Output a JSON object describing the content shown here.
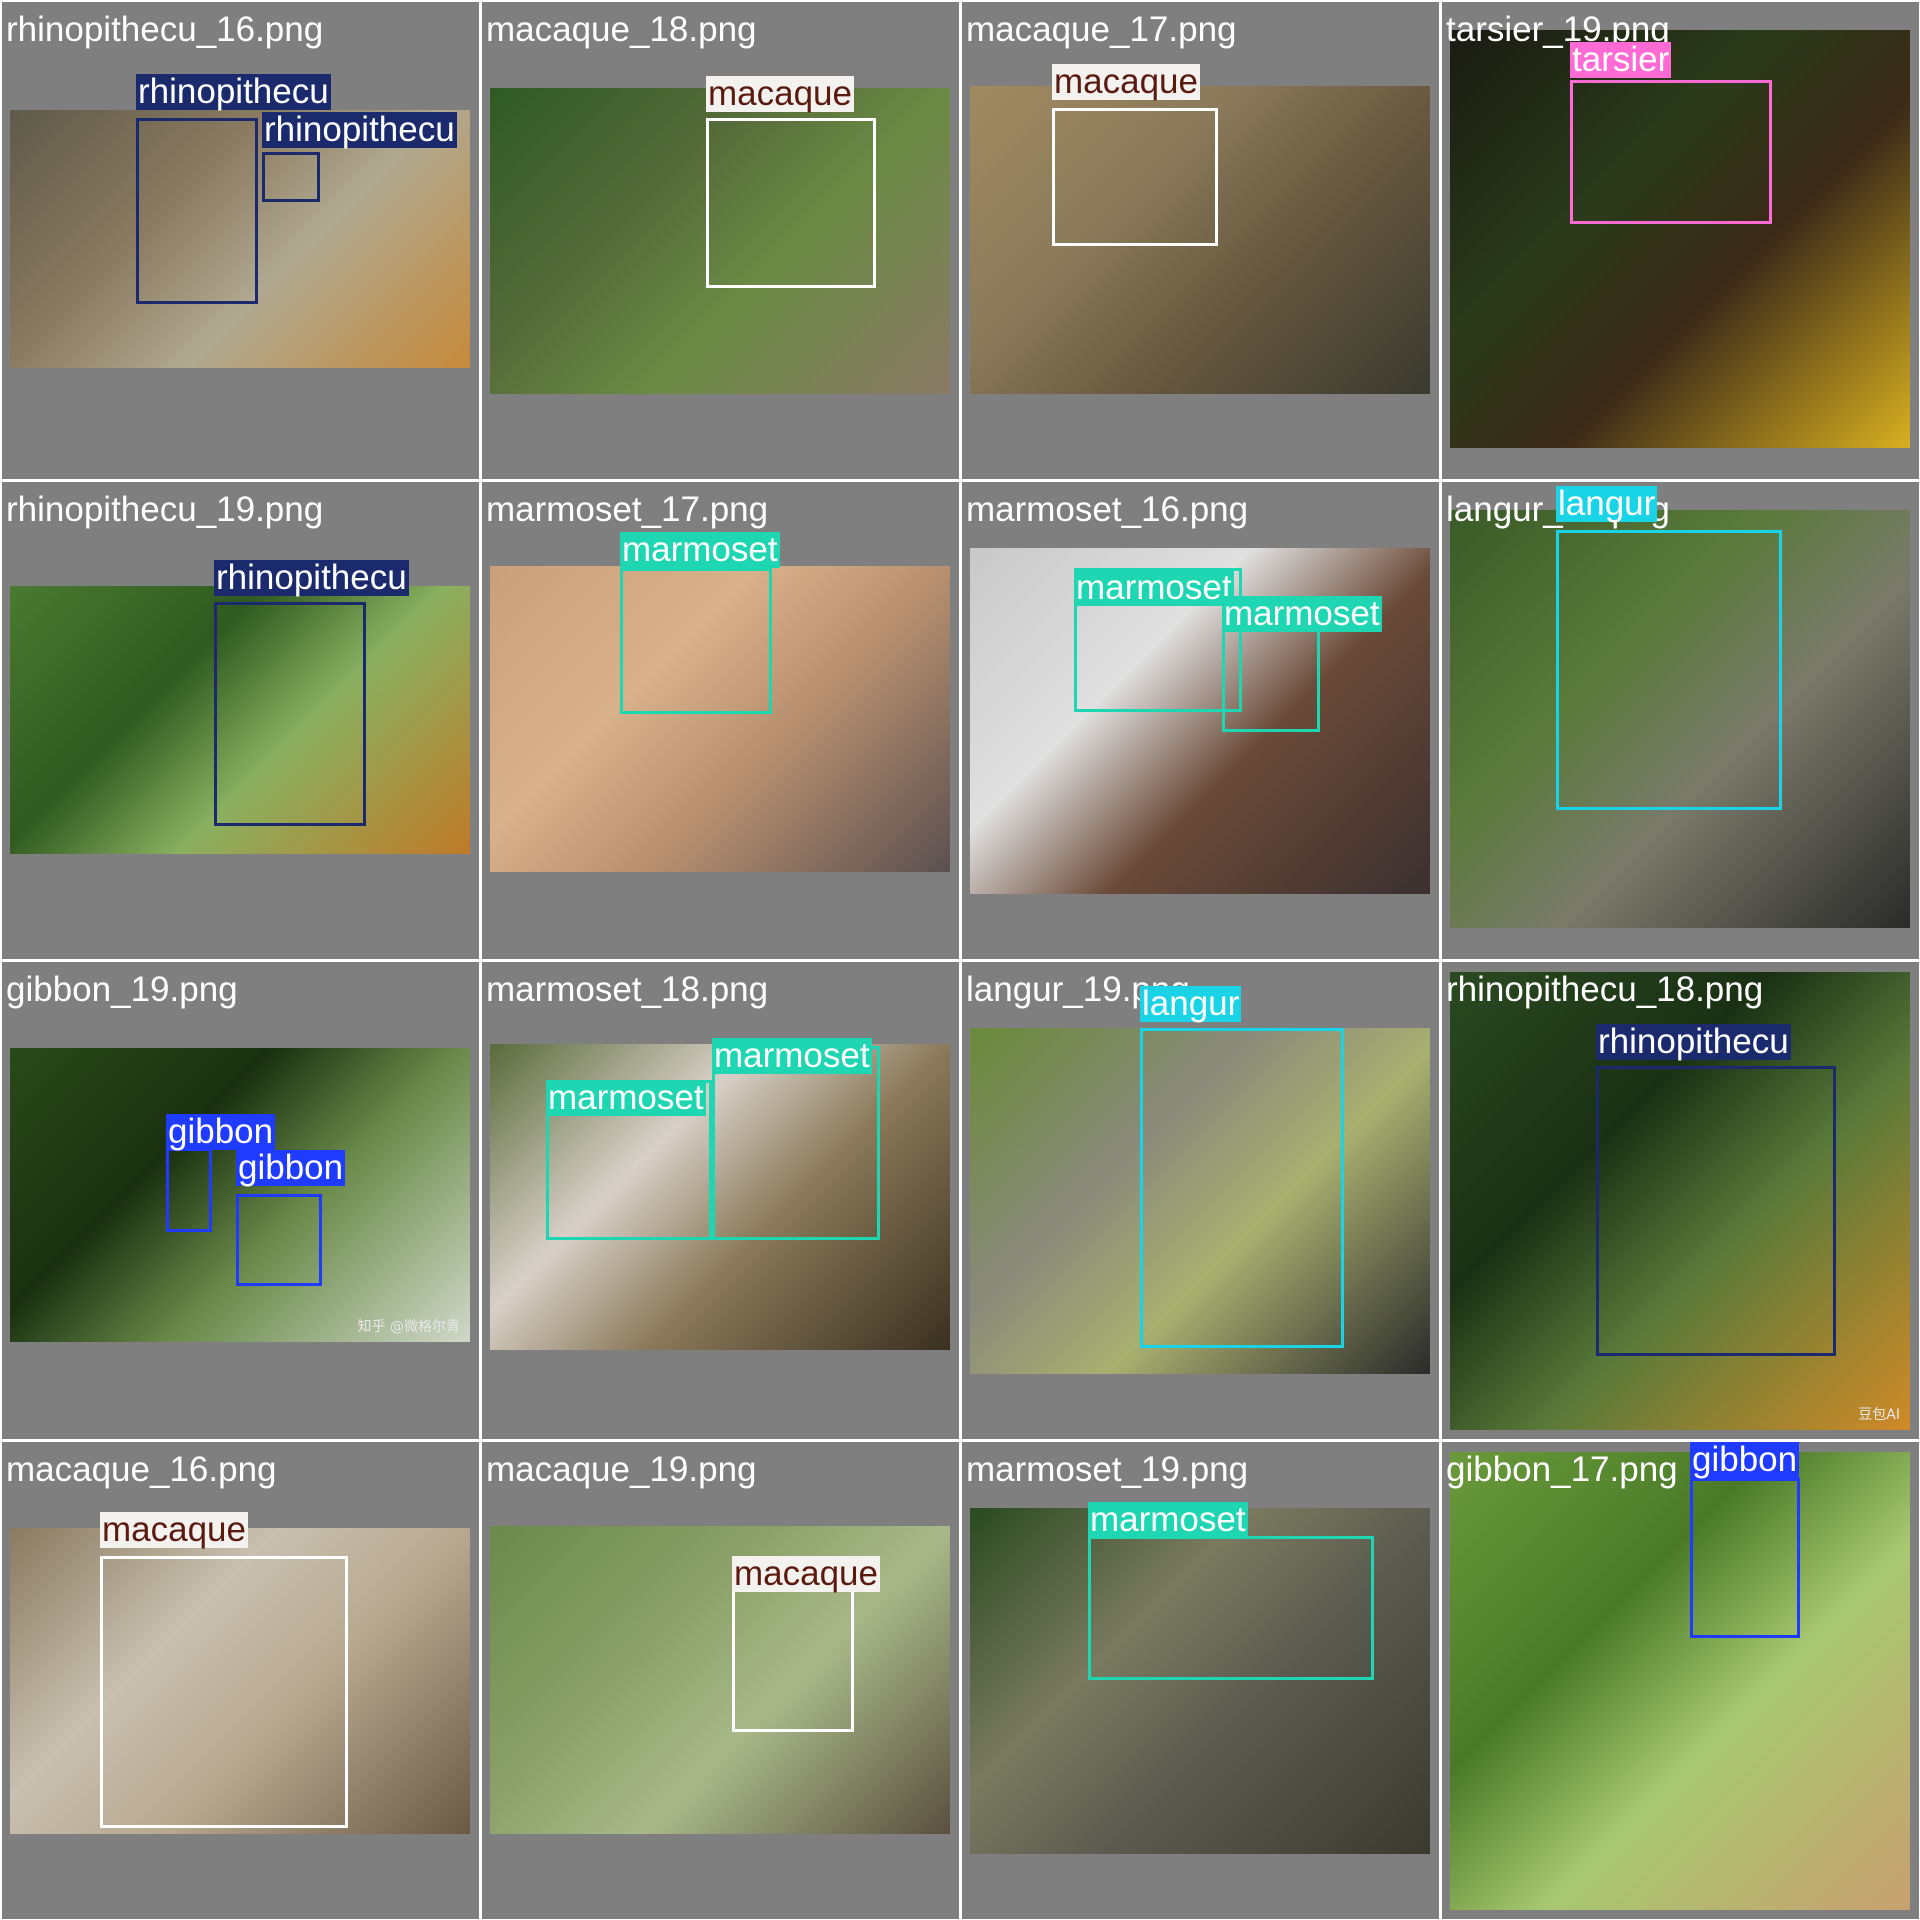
{
  "colors": {
    "background": "#7f7f7f",
    "macaque": "#ffffff",
    "rhinopithecu": "#1a2a6c",
    "tarsier": "#ff6ad5",
    "marmoset": "#1fd6b2",
    "langur": "#19d3e6",
    "gibbon": "#1f3bff"
  },
  "cells": [
    {
      "filename": "rhinopithecu_16.png",
      "photo_desc": "golden snub-nosed monkeys on rocks",
      "photo_colors": [
        "#5f5a4a",
        "#b0a890",
        "#c68a3a",
        "#8a7a60"
      ],
      "detections": [
        {
          "label": "rhinopithecu"
        },
        {
          "label": "rhinopithecu"
        }
      ]
    },
    {
      "filename": "macaque_18.png",
      "photo_desc": "macaque sitting on stone wall in greenery",
      "photo_colors": [
        "#2f5a24",
        "#6a8a44",
        "#8a7a66",
        "#556b3a"
      ],
      "detections": [
        {
          "label": "macaque"
        }
      ]
    },
    {
      "filename": "macaque_17.png",
      "photo_desc": "macaque walking near tree trunk",
      "photo_colors": [
        "#a08a60",
        "#6a5a40",
        "#3a3a30",
        "#8a7a5a"
      ],
      "detections": [
        {
          "label": "macaque"
        }
      ]
    },
    {
      "filename": "tarsier_19.png",
      "photo_desc": "slow loris on branch with yellow flowers",
      "photo_colors": [
        "#1a1a12",
        "#3a2a18",
        "#d8b020",
        "#2a3a1a"
      ],
      "detections": [
        {
          "label": "tarsier"
        }
      ]
    },
    {
      "filename": "rhinopithecu_19.png",
      "photo_desc": "golden snub-nosed monkey among leaves",
      "photo_colors": [
        "#4a7a30",
        "#8ab060",
        "#c07a28",
        "#2f5a20"
      ],
      "detections": [
        {
          "label": "rhinopithecu"
        }
      ]
    },
    {
      "filename": "marmoset_17.png",
      "photo_desc": "marmoset clinging to finger",
      "photo_colors": [
        "#c9a07a",
        "#b89070",
        "#5a5050",
        "#d8b08a"
      ],
      "detections": [
        {
          "label": "marmoset"
        }
      ]
    },
    {
      "filename": "marmoset_16.png",
      "photo_desc": "two marmosets on a log",
      "photo_colors": [
        "#c8c8c8",
        "#6a4a38",
        "#3a3030",
        "#e0e0e0"
      ],
      "detections": [
        {
          "label": "marmoset"
        },
        {
          "label": "marmoset"
        }
      ]
    },
    {
      "filename": "langur_16.png",
      "photo_desc": "dusky langur on mossy branch",
      "photo_colors": [
        "#3a5a28",
        "#7a7a6a",
        "#2a2a2a",
        "#5a7a3a"
      ],
      "detections": [
        {
          "label": "langur"
        }
      ]
    },
    {
      "filename": "gibbon_19.png",
      "photo_desc": "two gibbons in dense canopy",
      "photo_colors": [
        "#2a4a1a",
        "#6a8a4a",
        "#d0d8c8",
        "#1a3010"
      ],
      "detections": [
        {
          "label": "gibbon"
        },
        {
          "label": "gibbon"
        }
      ],
      "watermark": "知乎 @微格尔青"
    },
    {
      "filename": "marmoset_18.png",
      "photo_desc": "two tufted marmosets on mossy branch",
      "photo_colors": [
        "#5a6a3a",
        "#8a7a5a",
        "#3a3020",
        "#d8d0c8"
      ],
      "detections": [
        {
          "label": "marmoset"
        },
        {
          "label": "marmoset"
        }
      ]
    },
    {
      "filename": "langur_19.png",
      "photo_desc": "dusky langur holding tree trunk",
      "photo_colors": [
        "#6a8a3a",
        "#a8b070",
        "#2a2a2a",
        "#8a8a7a"
      ],
      "detections": [
        {
          "label": "langur"
        }
      ]
    },
    {
      "filename": "rhinopithecu_18.png",
      "photo_desc": "golden snub-nosed monkey eating banana",
      "photo_colors": [
        "#2a4a20",
        "#5a7a3a",
        "#d08a28",
        "#1a3014"
      ],
      "detections": [
        {
          "label": "rhinopithecu"
        }
      ],
      "watermark": "豆包AI"
    },
    {
      "filename": "macaque_16.png",
      "photo_desc": "close-up macaque face",
      "photo_colors": [
        "#8a7a60",
        "#b8a890",
        "#6a5a44",
        "#c8c0b0"
      ],
      "detections": [
        {
          "label": "macaque"
        }
      ]
    },
    {
      "filename": "macaque_19.png",
      "photo_desc": "macaque on rock in forest valley",
      "photo_colors": [
        "#6a8a4a",
        "#a8b888",
        "#5a5040",
        "#8aa068"
      ],
      "detections": [
        {
          "label": "macaque"
        }
      ]
    },
    {
      "filename": "marmoset_19.png",
      "photo_desc": "marmoset on tree stump",
      "photo_colors": [
        "#2a4a20",
        "#5a5a50",
        "#3a3a30",
        "#7a7a60"
      ],
      "detections": [
        {
          "label": "marmoset"
        }
      ]
    },
    {
      "filename": "gibbon_17.png",
      "photo_desc": "gibbon hanging from rope over grass",
      "photo_colors": [
        "#6a9a3a",
        "#a8c870",
        "#c8a070",
        "#4a7a28"
      ],
      "detections": [
        {
          "label": "gibbon"
        }
      ]
    }
  ]
}
